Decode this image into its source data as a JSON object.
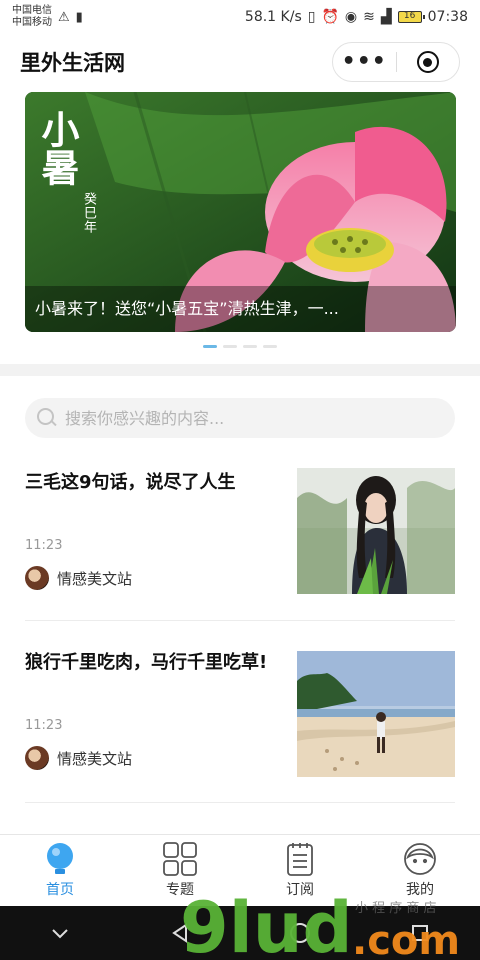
{
  "status_bar": {
    "carrier_1": "中国电信",
    "carrier_2": "中国移动",
    "speed": "58.1 K/s",
    "battery": "16",
    "time": "07:38"
  },
  "header": {
    "title": "里外生活网",
    "more_label": "•••"
  },
  "banner": {
    "art_title": "小暑",
    "art_subtitle": "癸巳年",
    "caption": "小暑来了！送您“小暑五宝”清热生津，一...",
    "dots": 4,
    "active_dot": 0
  },
  "search": {
    "placeholder": "搜索你感兴趣的内容..."
  },
  "articles": [
    {
      "title": "三毛这9句话，说尽了人生",
      "time": "11:23",
      "source": "情感美文站"
    },
    {
      "title": "狼行千里吃肉，马行千里吃草!",
      "time": "11:23",
      "source": "情感美文站"
    }
  ],
  "tabbar": {
    "items": [
      {
        "label": "首页",
        "icon": "home-bulb-icon",
        "active": true
      },
      {
        "label": "专题",
        "icon": "grid-icon",
        "active": false
      },
      {
        "label": "订阅",
        "icon": "notebook-icon",
        "active": false
      },
      {
        "label": "我的",
        "icon": "profile-icon",
        "active": false
      }
    ]
  },
  "watermark": {
    "text": "9lud.com",
    "small_text": "小程序商店"
  },
  "colors": {
    "accent": "#2a8fe0",
    "active_dot": "#6bb8e6",
    "band": "#f2f2f2"
  }
}
